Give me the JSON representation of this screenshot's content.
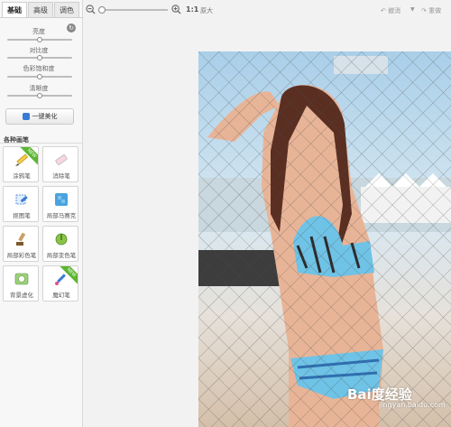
{
  "tabs": [
    {
      "label": "基础",
      "active": true
    },
    {
      "label": "高级",
      "active": false
    },
    {
      "label": "调色",
      "active": false
    }
  ],
  "adjust": {
    "reset_icon": "refresh-icon",
    "sliders": [
      {
        "label": "亮度",
        "value": 0.5
      },
      {
        "label": "对比度",
        "value": 0.5
      },
      {
        "label": "色彩饱和度",
        "value": 0.5
      },
      {
        "label": "清晰度",
        "value": 0.5
      }
    ],
    "beautify_label": "一键美化"
  },
  "tools": {
    "section_title": "各种画笔",
    "items": [
      {
        "label": "涂鸦笔",
        "icon": "pencil-icon",
        "badge": "NEW"
      },
      {
        "label": "消除笔",
        "icon": "eraser-icon",
        "badge": ""
      },
      {
        "label": "抠图笔",
        "icon": "cutout-pen-icon",
        "badge": ""
      },
      {
        "label": "局部马赛克",
        "icon": "mosaic-icon",
        "badge": ""
      },
      {
        "label": "局部彩色笔",
        "icon": "color-brush-icon",
        "badge": ""
      },
      {
        "label": "局部变色笔",
        "icon": "recolor-pen-icon",
        "badge": ""
      },
      {
        "label": "背景虚化",
        "icon": "blur-background-icon",
        "badge": ""
      },
      {
        "label": "魔幻笔",
        "icon": "magic-pen-icon",
        "badge": "NEW"
      }
    ]
  },
  "toolbar": {
    "zoom_value": 0.05,
    "ratio_label": "1:1",
    "fit_label": "原大",
    "undo_label": "撤消",
    "redo_label": "重做"
  },
  "photo": {
    "description_icon": "photo",
    "watermark": "Bai度经验",
    "watermark_sub": "jingyan.baidu.com"
  },
  "colors": {
    "accent": "#3a7bd5",
    "badge_green": "#5cb531"
  }
}
